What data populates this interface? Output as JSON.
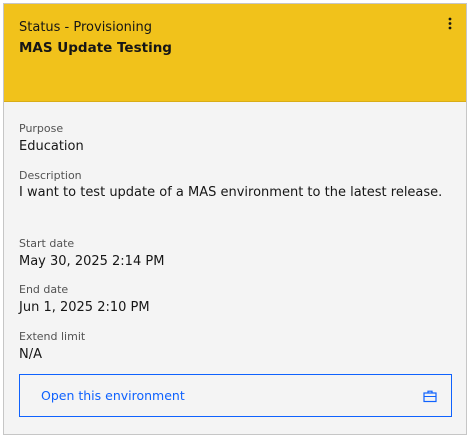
{
  "header": {
    "status": "Status - Provisioning",
    "title": "MAS Update Testing",
    "menu_icon": "overflow-menu-vertical-icon",
    "background_color": "#f1c21b"
  },
  "fields": {
    "purpose": {
      "label": "Purpose",
      "value": "Education"
    },
    "description": {
      "label": "Description",
      "value": "I want to test update of a MAS environment to the latest release."
    },
    "start_date": {
      "label": "Start date",
      "value": "May 30, 2025 2:14 PM"
    },
    "end_date": {
      "label": "End date",
      "value": "Jun 1, 2025 2:10 PM"
    },
    "extend_limit": {
      "label": "Extend limit",
      "value": "N/A"
    }
  },
  "action": {
    "label": "Open this environment",
    "icon": "briefcase-icon",
    "color": "#0f62fe"
  }
}
